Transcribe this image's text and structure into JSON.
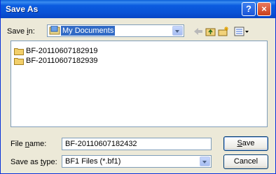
{
  "window": {
    "title": "Save As"
  },
  "title_buttons": {
    "help": "?",
    "close": "×"
  },
  "save_in": {
    "label_pre": "Save ",
    "label_u": "i",
    "label_post": "n:",
    "value": "My Documents"
  },
  "toolbar": {
    "icons": [
      "back-icon",
      "up-folder-icon",
      "new-folder-icon",
      "view-menu-icon"
    ]
  },
  "files": [
    {
      "name": "BF-20110607182919",
      "icon": "folder-icon"
    },
    {
      "name": "BF-20110607182939",
      "icon": "folder-icon"
    }
  ],
  "file_name": {
    "label_pre": "File ",
    "label_u": "n",
    "label_post": "ame:",
    "value": "BF-20110607182432"
  },
  "save_as_type": {
    "label_pre": "Save as ",
    "label_u": "t",
    "label_post": "ype:",
    "value": "BF1 Files (*.bf1)"
  },
  "buttons": {
    "save_u": "S",
    "save_rest": "ave",
    "cancel": "Cancel"
  },
  "colors": {
    "title_bar": "#0a53d6",
    "dialog_bg": "#ece9d8",
    "selection": "#316ac5"
  }
}
